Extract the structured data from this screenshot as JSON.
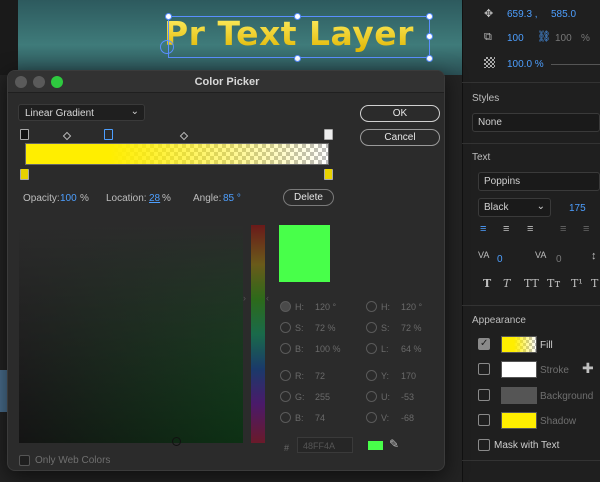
{
  "app": {
    "title_layer_text": "Pr Text Layer"
  },
  "right_panel": {
    "position_x": "659.3 ,",
    "position_y": "585.0",
    "scale": "100",
    "scale_linked": "100",
    "scale_unit": "%",
    "opacity": "100.0 %",
    "styles_label": "Styles",
    "styles_value": "None",
    "text_label": "Text",
    "font_family": "Poppins",
    "font_style": "Black",
    "font_size": "175",
    "tracking_value": "0",
    "kerning_value": "0",
    "appearance_label": "Appearance",
    "fill_label": "Fill",
    "stroke_label": "Stroke",
    "background_label": "Background",
    "shadow_label": "Shadow",
    "mask_label": "Mask with Text",
    "colors": {
      "fill_from": "#ffee00",
      "stroke": "#ffffff",
      "background": "#555555",
      "shadow": "#ffee00"
    }
  },
  "dialog": {
    "title": "Color Picker",
    "gradient_type": "Linear Gradient",
    "ok_label": "OK",
    "cancel_label": "Cancel",
    "opacity_label": "Opacity:",
    "opacity_value": "100",
    "opacity_unit": "%",
    "location_label": "Location:",
    "location_value": "28",
    "location_unit": "%",
    "angle_label": "Angle:",
    "angle_value": "85 °",
    "delete_label": "Delete",
    "new_color": "#48ff4a",
    "hsb": [
      {
        "label": "H:",
        "value": "120 °"
      },
      {
        "label": "S:",
        "value": "72 %"
      },
      {
        "label": "B:",
        "value": "100 %"
      }
    ],
    "hsl": [
      {
        "label": "H:",
        "value": "120 °"
      },
      {
        "label": "S:",
        "value": "72 %"
      },
      {
        "label": "L:",
        "value": "64 %"
      }
    ],
    "rgb": [
      {
        "label": "R:",
        "value": "72"
      },
      {
        "label": "G:",
        "value": "255"
      },
      {
        "label": "B:",
        "value": "74"
      }
    ],
    "yuv": [
      {
        "label": "Y:",
        "value": "170"
      },
      {
        "label": "U:",
        "value": "-53"
      },
      {
        "label": "V:",
        "value": "-68"
      }
    ],
    "hex_prefix": "#",
    "hex_value": "48FF4A",
    "web_colors_label": "Only Web Colors"
  }
}
